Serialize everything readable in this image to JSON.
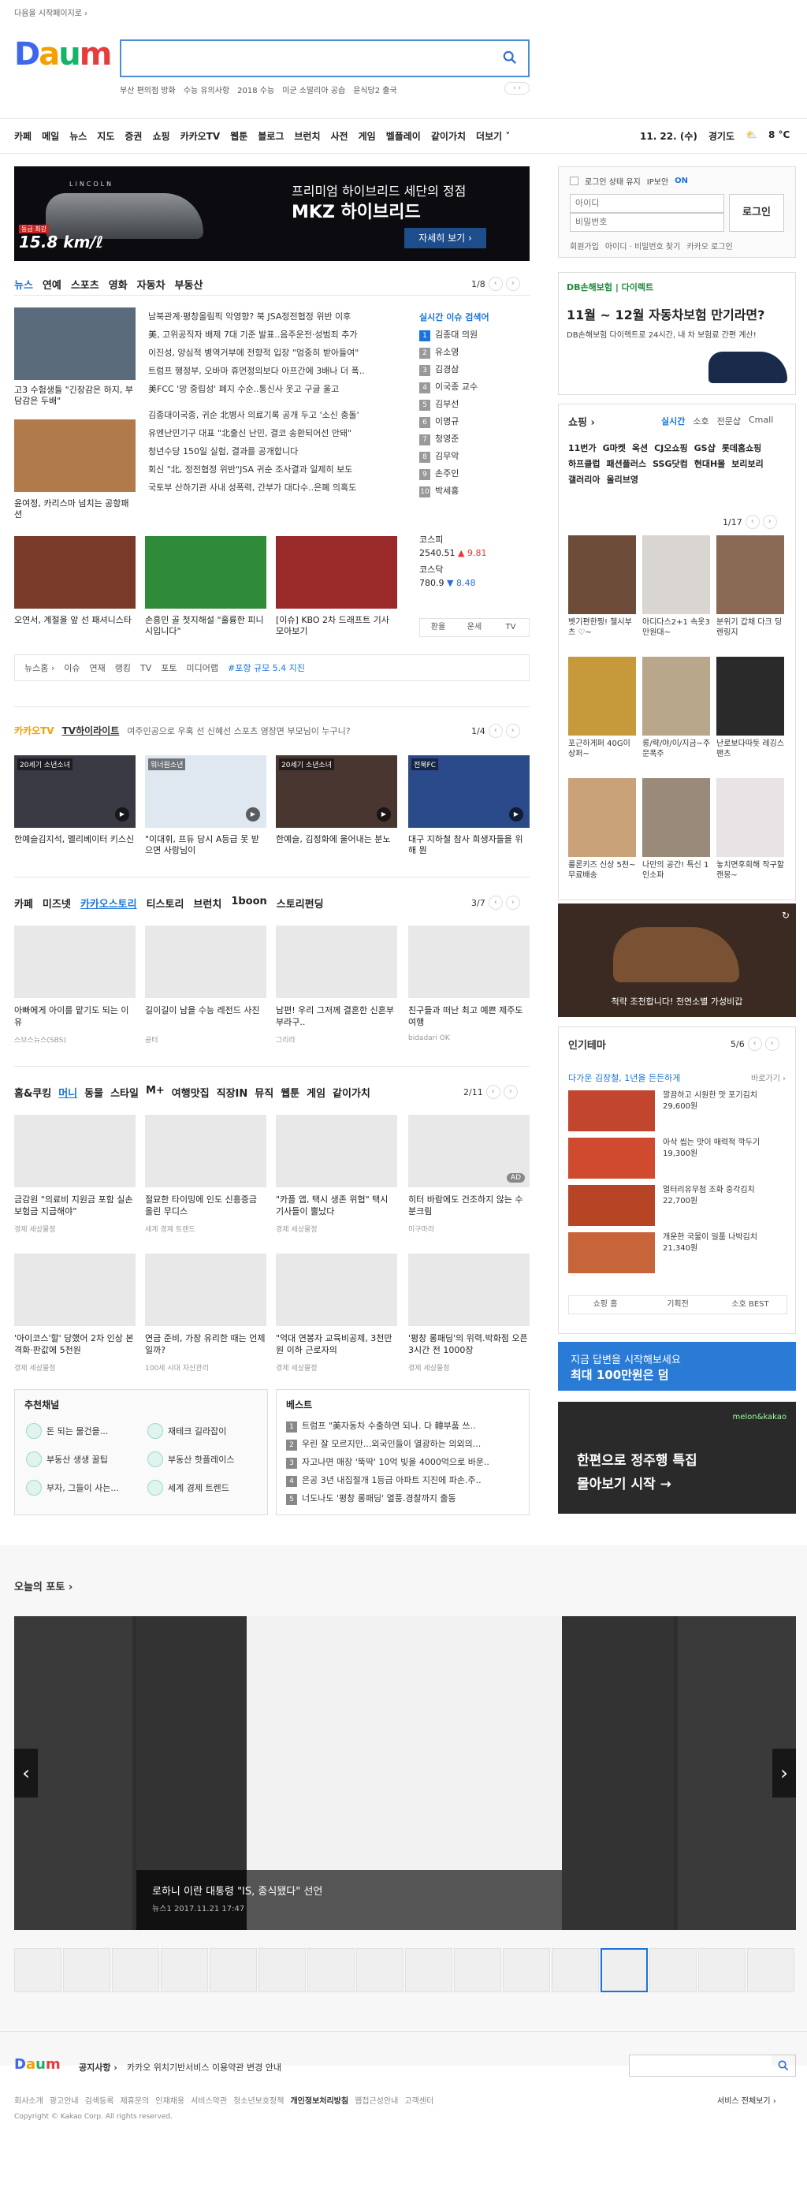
{
  "top": {
    "start_text": "다음을 시작페이지로 ›"
  },
  "logo": {
    "d": "D",
    "a": "a",
    "u": "u",
    "m": "m"
  },
  "search": {
    "placeholder": "",
    "hotwords": [
      "부산 편의점 방화",
      "수능 유의사항",
      "2018 수능",
      "미군 소말리아 공습",
      "윤식당2 출국"
    ],
    "nav": "‹ ›"
  },
  "gnb": {
    "items": [
      "카페",
      "메일",
      "뉴스",
      "지도",
      "증권",
      "쇼핑",
      "카카오TV",
      "웹툰",
      "블로그",
      "브런치",
      "사전",
      "게임",
      "벨플레이",
      "같이가치",
      "더보기 ˅"
    ]
  },
  "date": {
    "day": "11. 22. (수)",
    "region": "경기도",
    "temp": "8 °C"
  },
  "ad": {
    "brand": "LINCOLN",
    "price_label": "동급 최강",
    "price": "15.8 km/ℓ",
    "line1": "프리미엄 하이브리드 세단의 정점",
    "line2": "MKZ 하이브리드",
    "button": "자세히 보기 ›"
  },
  "news": {
    "tabs": [
      "뉴스",
      "연예",
      "스포츠",
      "영화",
      "자동차",
      "부동산"
    ],
    "page": "1/8",
    "headlines": [
      "남북관계·평창올림픽 악영향? 북 JSA정전협정 위반 이후",
      "美, 고위공직자 배제 7대 기준 발표..음주운전·성범죄 추가",
      "이진성, 양심적 병역거부에 전향적 입장 \"엄중히 받아들여\"",
      "트럼프 행정부, 오바마 휴먼정의보다 아프간에 3배나 더 폭..",
      "美FCC '망 중립성' 폐지 수순..통신사 웃고 구글 울고",
      "김종대이국종, 귀순 北병사 의료기록 공개 두고 '소신 충돌'",
      "유엔난민기구 대표 \"北출신 난민, 결코 송환되어선 안돼\"",
      "청년수당 150일 실험, 결과를 공개합니다",
      "회신 \"北, 정전협정 위반\"JSA 귀순 조사결과 일제히 보도",
      "국토부 산하기관 사내 성폭력, 간부가 대다수..은폐 의혹도"
    ],
    "thumb_caps": [
      "고3 수험생들 \"긴장감은 하지, 부담감은 두배\"",
      "윤여정, 카리스마 넘치는 공항패션",
      "오연서, 계절을 앞 선 패셔니스타",
      "손흥민 골 첫지해설 \"훌륭한 피니시입니다\"",
      "[이슈] KBO 2차 드래프트 기사 모아보기"
    ],
    "bottom_links": [
      "뉴스홈 ›",
      "이슈",
      "연재",
      "랭킹",
      "TV",
      "포토",
      "미디어랩",
      "#포항 규모 5.4 지진"
    ]
  },
  "rank": {
    "header": "실시간 이슈 검색어",
    "items": [
      "김종대 의원",
      "유소영",
      "김경삼",
      "이국종 교수",
      "김부선",
      "이명규",
      "청영준",
      "김무악",
      "손주인",
      "박세홍"
    ]
  },
  "stock": {
    "kospi_label": "코스피",
    "kospi": "2540.51",
    "kospi_chg": "▲ 9.81",
    "kosdaq_label": "코스닥",
    "kosdaq": "780.9",
    "kosdaq_chg": "▼ 8.48",
    "tabs": [
      "환율",
      "운세",
      "TV"
    ]
  },
  "kakaotv": {
    "title": "카카오TV",
    "subtitle": "TV하이라이트",
    "ticker": "여주인공으로 우혹 선 신혜선   스포츠 영장면   부모님이 누구니?",
    "page": "1/4",
    "badges": [
      "20세기 소년소녀",
      "워너원소년",
      "20세기 소년소녀",
      "전북FC"
    ],
    "caps": [
      "한예슬김지석, 멜리베이터 키스신",
      "\"이대휘, 프듀 당시 A등급 못 받으면 사랑님이",
      "한예슬, 김정화에 울어내는 분노",
      "대구 지하철 참사 희생자들을 위해 뭔"
    ]
  },
  "cafe": {
    "tabs": [
      "카페",
      "미즈넷",
      "카카오스토리",
      "티스토리",
      "브런치",
      "1boon",
      "스토리펀딩"
    ],
    "page": "3/7",
    "caps": [
      "아빠에게 아이를 맡기도 되는 이유",
      "길이길이 남을 수능 레전드 사진",
      "남편! 우리 그저께 결혼한 신혼부부라구..",
      "친구들과 떠난 최고 예쁜 제주도여행"
    ],
    "srcs": [
      "스브스뉴스(SBS)",
      "공터",
      "그리라",
      "bidadari OK"
    ]
  },
  "money": {
    "tabs": [
      "홈&쿠킹",
      "머니",
      "동물",
      "스타일",
      "M+",
      "여행맛집",
      "직장IN",
      "뮤직",
      "웹툰",
      "게임",
      "같이가치"
    ],
    "page": "2/11",
    "caps": [
      "금감원 \"의료비 지원금 포함 실손보험금 지급해야\"",
      "절묘한 타이밍에 인도 신흥증금 올린 무디스",
      "\"카플 앱, 택시 생존 위협\" 택시 기사들이 뿔났다",
      "히터 바람에도 건조하지 않는 수분크림",
      "'아이코스'할' 당했어 2차 인상 본격화·판값에 5천원",
      "연금 준비, 가장 유리한 때는 언제일까?",
      "\"억대 연봉자 교육비공제, 3천만원 이하 근로자의",
      "'평창 롱패딩'의 위력.박화점 오픈 3시간 전 1000장"
    ],
    "srcs": [
      "경제 세상물정",
      "세계 경제 트렌드",
      "경제 세상물정",
      "미구마라",
      "경제 세상물정",
      "100세 시대 자산관리",
      "경제 세상물정",
      "경제 세상물정"
    ],
    "ad": "AD"
  },
  "channel": {
    "title": "추천채널",
    "items": [
      "돈 되는 물건을...",
      "재테크 길라잡이",
      "부동산 생생 꿀팁",
      "부동산 핫플레이스",
      "부자, 그들이 사는...",
      "세계 경제 트렌드"
    ]
  },
  "best": {
    "title": "베스트",
    "items": [
      "트럼프 \"美자동차 수출하면 되나. 다 韓부품 쓰..",
      "우린 잘 모르지만...외국인들이 열광하는 의외의...",
      "자고나면 매장 '뚝딱' 10억 빚을 4000억으로 바운..",
      "은공 3년 내집절개 1등급 아파트 지진에 파손.주..",
      "너도나도 '평창 롱패딩' 열풍.경찰까지 출동"
    ]
  },
  "login": {
    "keep": "로그인 상태 유지",
    "ip": "IP보안",
    "ip_on": "ON",
    "id_ph": "아이디",
    "pw_ph": "비밀번호",
    "button": "로그인",
    "links": [
      "회원가입",
      "아이디 · 비밀번호 찾기",
      "카카오 로그인"
    ]
  },
  "dbad": {
    "brand": "DB손해보험 | 다이렉트",
    "title1": "11월 ~ 12월 자동차보험 만기라면?",
    "desc": "DB손해보험 다이렉트로 24시간, 내 차 보험료 간편 계산!"
  },
  "shopping": {
    "title": "쇼핑 ›",
    "tabs": [
      "실시간",
      "소호",
      "전문샵",
      "Cmall"
    ],
    "brands": [
      "11번가",
      "G마켓",
      "옥션",
      "CJ오쇼핑",
      "GS샵",
      "롯데홈쇼핑",
      "하프클럽",
      "패션플러스",
      "SSG닷컴",
      "현대H몰",
      "보리보리",
      "갤러리아",
      "올리브영"
    ],
    "page": "1/17",
    "items": [
      "벳기편한찡! 첼시부츠 ♡~",
      "아디다스2+1 속옷3만원대~",
      "분위기 갑채 다크 딩렌링지",
      "포근하게퍼 40G이상퍼~",
      "롱/략/야/이/지금~주문폭주",
      "난로보다따듯 레깅스팬츠",
      "룰론키즈 신상 5천~무료배송",
      "나만의 공간! 특신 1인소파",
      "놓치면후회해 작구할캔몽~"
    ],
    "banner": "척략 조천합니다! 천연소별 가성비갑"
  },
  "theme": {
    "title": "인기테마",
    "page": "5/6",
    "tagline": "다가운 김장철, 1년을 든든하게",
    "more": "바로가기 ›",
    "items": [
      {
        "t": "깔끔하고 시원한 맛 포기김치",
        "p": "29,600원"
      },
      {
        "t": "아삭 씹는 맛이 매력적 깍두기",
        "p": "19,300원"
      },
      {
        "t": "얼터리유무첨 조화 중각김치",
        "p": "22,700원"
      },
      {
        "t": "개운한 국물이 일품 나박김치",
        "p": "21,340원"
      }
    ],
    "tabs": [
      "쇼핑 홈",
      "기획전",
      "소호 BEST"
    ]
  },
  "banner1": {
    "l1": "지금 답변을 시작해보세요",
    "l2": "최대 100만원은 덤"
  },
  "banner2": {
    "brand": "melon&kakao",
    "l1": "한편으로 정주행 특집",
    "l2": "몰아보기 시작 →"
  },
  "photo": {
    "title": "오늘의 포토 ›",
    "caption": "로하니 이란 대통령 \"IS, 종식됐다\" 선언",
    "meta": "뉴스1   2017.11.21 17:47"
  },
  "footer": {
    "notice_label": "공지사항 ›",
    "notice": "카카오 위치기반서비스 이용약관 변경 안내",
    "links": [
      "회사소개",
      "광고안내",
      "검색등록",
      "제휴문의",
      "인재채용",
      "서비스약관",
      "청소년보호정책",
      "개인정보처리방침",
      "웹접근성안내",
      "고객센터"
    ],
    "all": "서비스 전체보기 ›",
    "copy": "Copyright © Kakao Corp. All rights reserved."
  },
  "colors": {
    "accent": "#1a73d9",
    "brand_blue": "#3e67ee"
  }
}
